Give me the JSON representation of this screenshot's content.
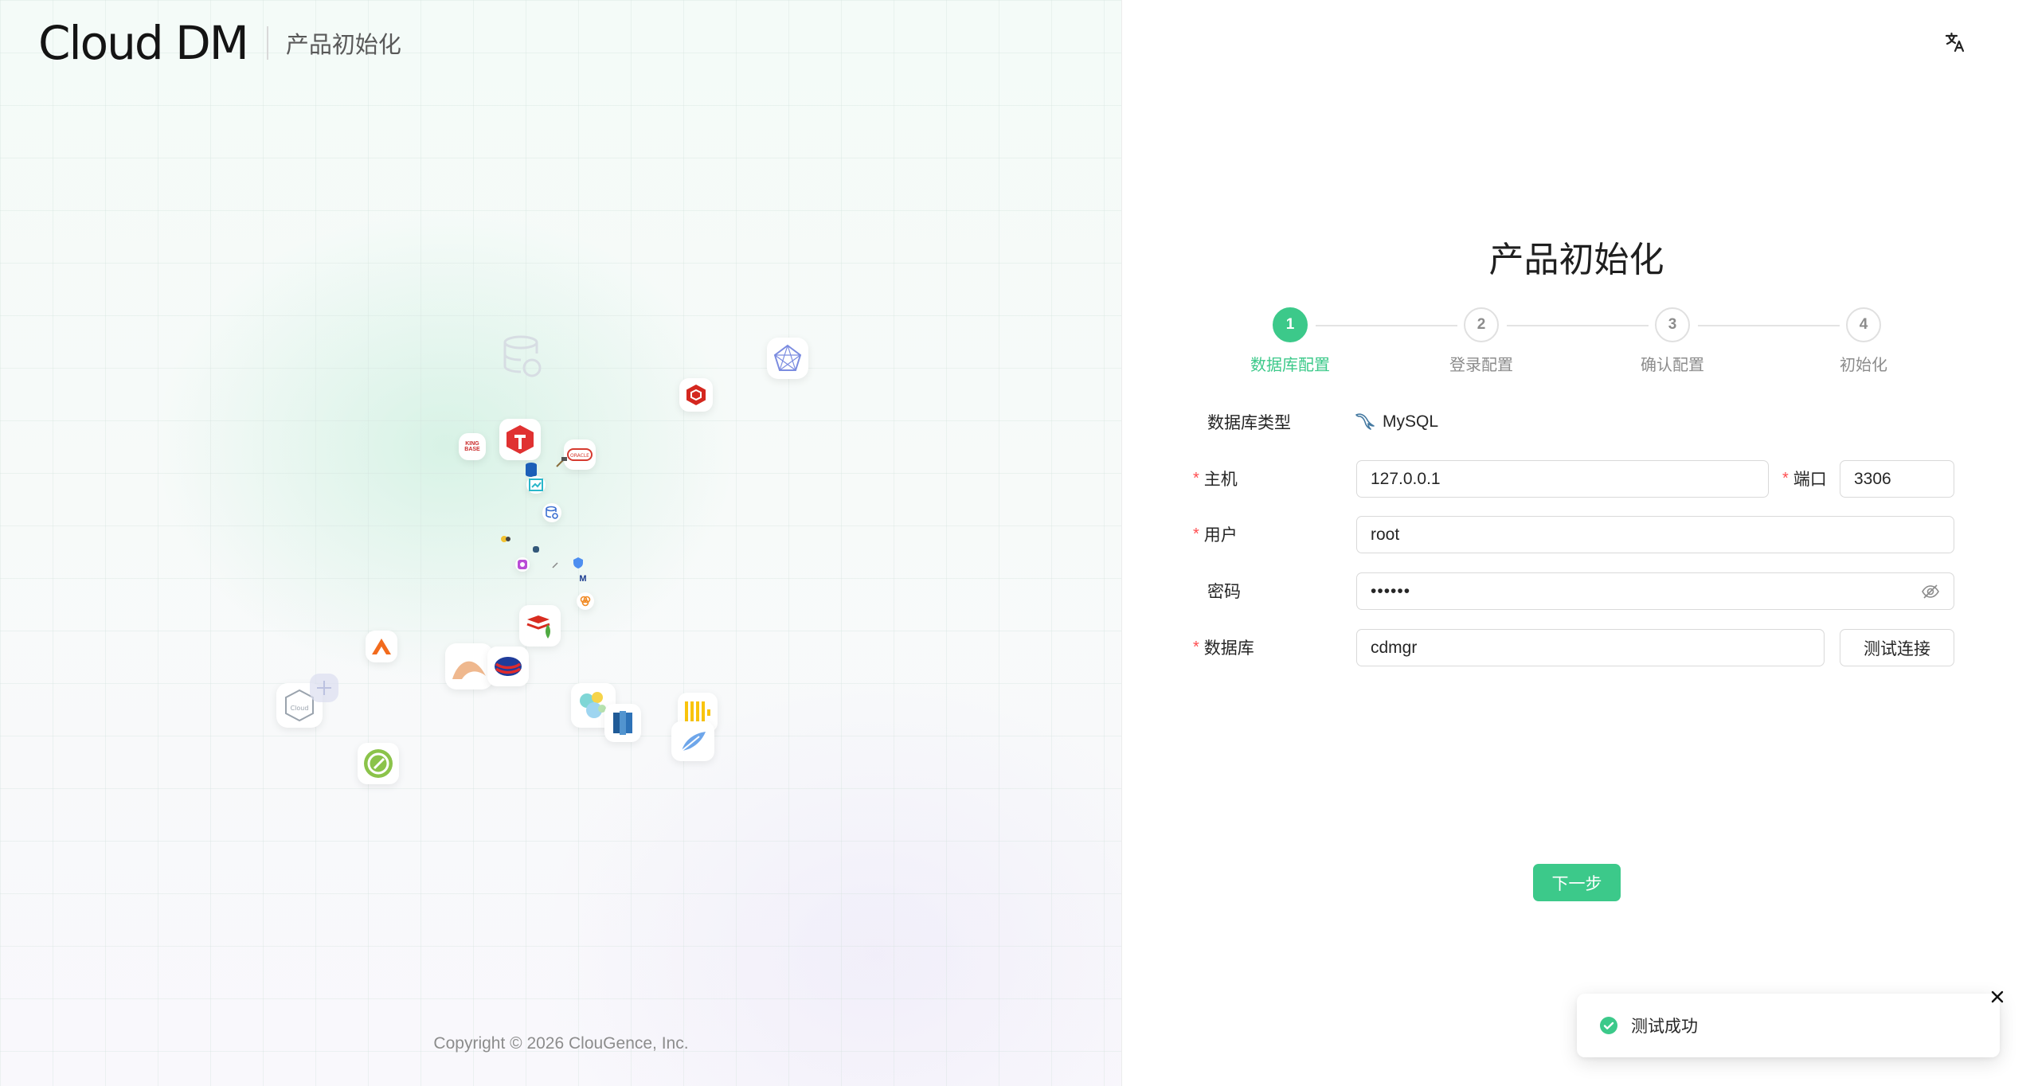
{
  "brand": {
    "logo_text": "Cloud DM",
    "subtitle": "产品初始化"
  },
  "footer": {
    "copyright": "Copyright © 2026 ClouGence, Inc."
  },
  "header": {
    "language_icon": "translate-icon"
  },
  "form": {
    "title": "产品初始化",
    "steps": [
      {
        "number": "1",
        "label": "数据库配置",
        "active": true
      },
      {
        "number": "2",
        "label": "登录配置",
        "active": false
      },
      {
        "number": "3",
        "label": "确认配置",
        "active": false
      },
      {
        "number": "4",
        "label": "初始化",
        "active": false
      }
    ],
    "db_type": {
      "label": "数据库类型",
      "value": "MySQL",
      "icon": "mysql-dolphin-icon"
    },
    "host": {
      "label": "主机",
      "value": "127.0.0.1",
      "required": true
    },
    "port": {
      "label": "端口",
      "value": "3306",
      "required": true
    },
    "user": {
      "label": "用户",
      "value": "root",
      "required": true
    },
    "password": {
      "label": "密码",
      "value": "••••••",
      "required": false,
      "toggle_icon": "eye-invisible-icon"
    },
    "database": {
      "label": "数据库",
      "value": "cdmgr",
      "required": true
    },
    "test_button": "测试连接",
    "next_button": "下一步",
    "required_mark": "*"
  },
  "toast": {
    "message": "测试成功",
    "status": "success",
    "close_icon": "close-icon"
  },
  "colors": {
    "primary": "#3cc98a",
    "required": "#ff4d4f",
    "border": "#d9d9d9",
    "muted": "#8c8c8c"
  }
}
